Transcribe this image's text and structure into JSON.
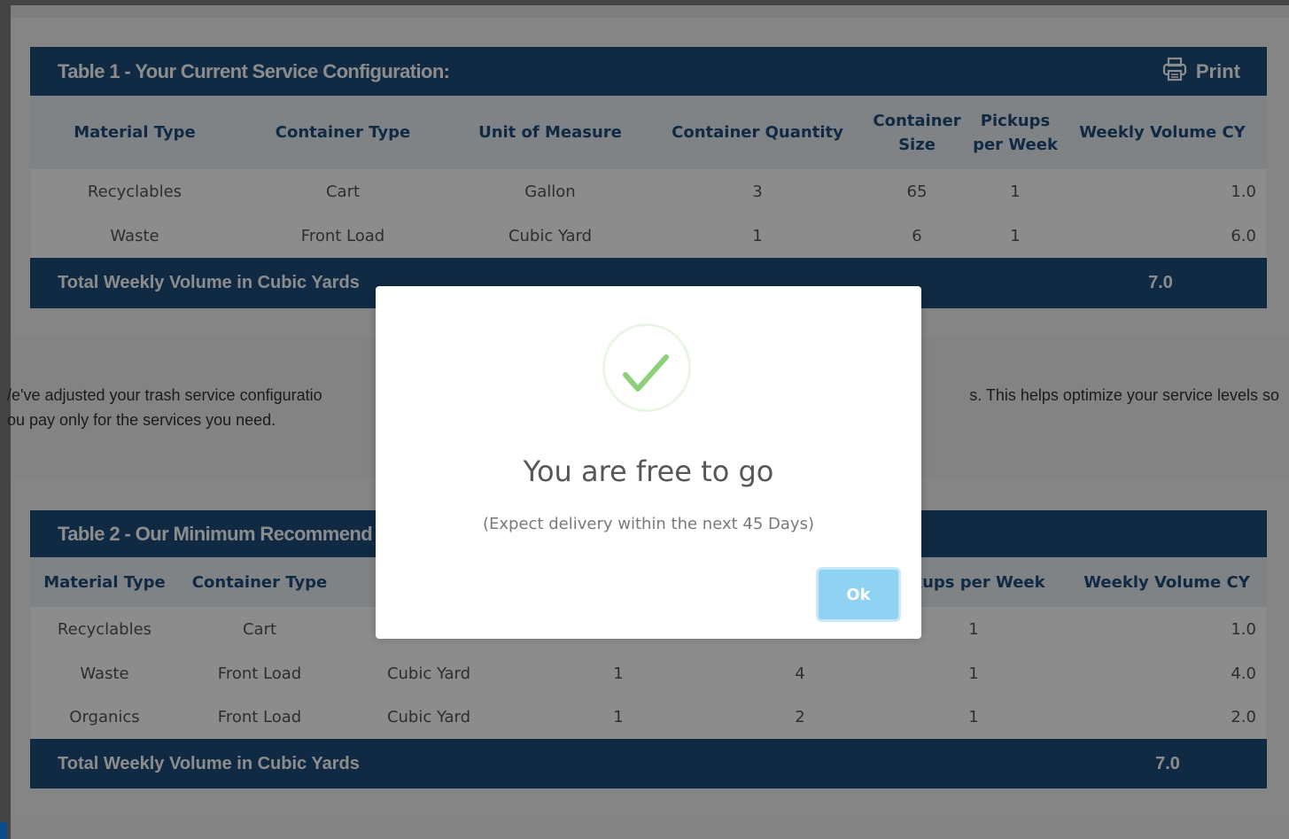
{
  "table1": {
    "title": "Table 1 - Your Current Service Configuration:",
    "print_label": "Print",
    "columns": [
      "Material Type",
      "Container Type",
      "Unit of Measure",
      "Container Quantity",
      "Container Size",
      "Pickups per Week",
      "Weekly Volume CY"
    ],
    "rows": [
      [
        "Recyclables",
        "Cart",
        "Gallon",
        "3",
        "65",
        "1",
        "1.0"
      ],
      [
        "Waste",
        "Front Load",
        "Cubic Yard",
        "1",
        "6",
        "1",
        "6.0"
      ]
    ],
    "total_label": "Total Weekly Volume in Cubic Yards",
    "total_value": "7.0"
  },
  "paragraph": {
    "line1_left": "/e've adjusted your trash service configuratio",
    "line1_right": "s. This helps optimize your service levels so",
    "line2": "ou pay only for the services you need."
  },
  "table2": {
    "title": "Table 2 - Our Minimum Recommend",
    "columns": [
      "Material Type",
      "Container Type",
      "U",
      "",
      "",
      "ckups per Week",
      "Weekly Volume CY"
    ],
    "rows": [
      [
        "Recyclables",
        "Cart",
        "",
        "",
        "",
        "1",
        "1.0"
      ],
      [
        "Waste",
        "Front Load",
        "Cubic Yard",
        "1",
        "4",
        "1",
        "4.0"
      ],
      [
        "Organics",
        "Front Load",
        "Cubic Yard",
        "1",
        "2",
        "1",
        "2.0"
      ]
    ],
    "total_label": "Total Weekly Volume in Cubic Yards",
    "total_value": "7.0"
  },
  "modal": {
    "icon": "checkmark-icon",
    "title": "You are free to go",
    "subtitle": "(Expect delivery within the next 45 Days)",
    "ok_label": "Ok"
  },
  "colors": {
    "header_blue": "#1e4d7d",
    "column_header_bg": "#e8eef3",
    "check_green": "#8ed17d",
    "ok_button": "#8fd2f2"
  }
}
